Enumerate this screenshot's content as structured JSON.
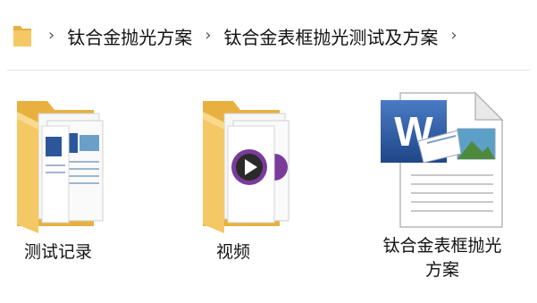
{
  "breadcrumb": {
    "items": [
      {
        "label": "钛合金抛光方案"
      },
      {
        "label": "钛合金表框抛光测试及方案"
      }
    ]
  },
  "files": [
    {
      "label": "测试记录",
      "type": "folder"
    },
    {
      "label": "视频",
      "type": "folder"
    },
    {
      "label": "钛合金表框抛光\n方案",
      "type": "word-document"
    }
  ],
  "colors": {
    "folder": "#f5c866",
    "folder_dark": "#e8b03f",
    "word_blue": "#2b579a",
    "play_purple": "#7a3b9a"
  }
}
